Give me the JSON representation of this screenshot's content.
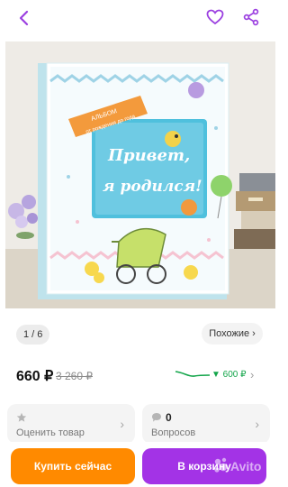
{
  "topbar": {
    "back_icon": "chevron-left-icon",
    "favorite_icon": "heart-icon",
    "share_icon": "share-icon"
  },
  "photo": {
    "album_label": "АЛЬБОМ",
    "album_sub": "от рождения до года",
    "title_line1": "Привет,",
    "title_line2": "я родился!"
  },
  "gallery": {
    "counter": "1 / 6",
    "similar_label": "Похожие ›"
  },
  "price": {
    "current": "660 ₽",
    "old": "3 260 ₽",
    "trend_value": "▼ 600 ₽"
  },
  "cards": [
    {
      "count": "",
      "label": "Оценить товар",
      "icon": "star-icon"
    },
    {
      "count": "0",
      "label": "Вопросов",
      "icon": "chat-bubble-icon"
    }
  ],
  "actions": {
    "buy_label": "Купить сейчас",
    "cart_label": "В корзину"
  },
  "watermark": {
    "text": "Avito"
  },
  "colors": {
    "accent_purple": "#a333e6",
    "buy_orange": "#ff8a00",
    "trend_green": "#13a54a"
  }
}
